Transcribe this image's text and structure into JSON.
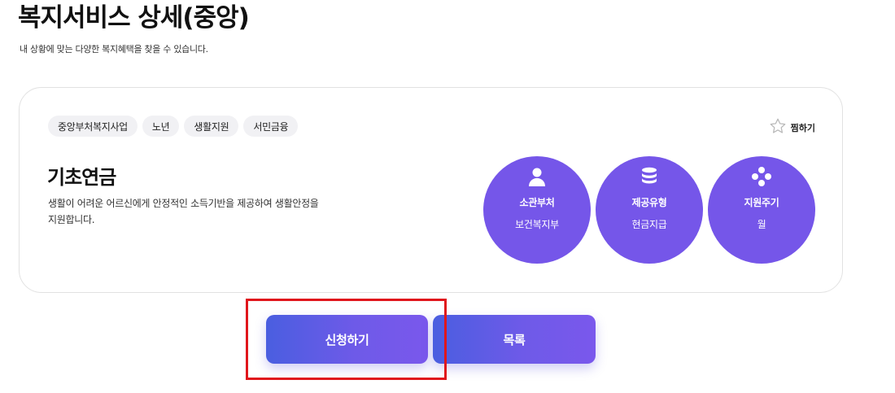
{
  "header": {
    "title": "복지서비스 상세(중앙)",
    "subtitle": "내 상황에 맞는 다양한 복지혜택을 찾을 수 있습니다."
  },
  "card": {
    "tags": [
      "중앙부처복지사업",
      "노년",
      "생활지원",
      "서민금융"
    ],
    "favorite_label": "찜하기",
    "service_name": "기초연금",
    "description": "생활이 어려운 어르신에게 안정적인 소득기반을 제공하여 생활안정을 지원합니다.",
    "info": [
      {
        "icon": "person-icon",
        "label": "소관부처",
        "value": "보건복지부"
      },
      {
        "icon": "database-icon",
        "label": "제공유형",
        "value": "현금지급"
      },
      {
        "icon": "cycle-icon",
        "label": "지원주기",
        "value": "월"
      }
    ]
  },
  "actions": {
    "apply_label": "신청하기",
    "list_label": "목록"
  },
  "colors": {
    "accent": "#7556e9",
    "highlight": "#e0161c"
  }
}
